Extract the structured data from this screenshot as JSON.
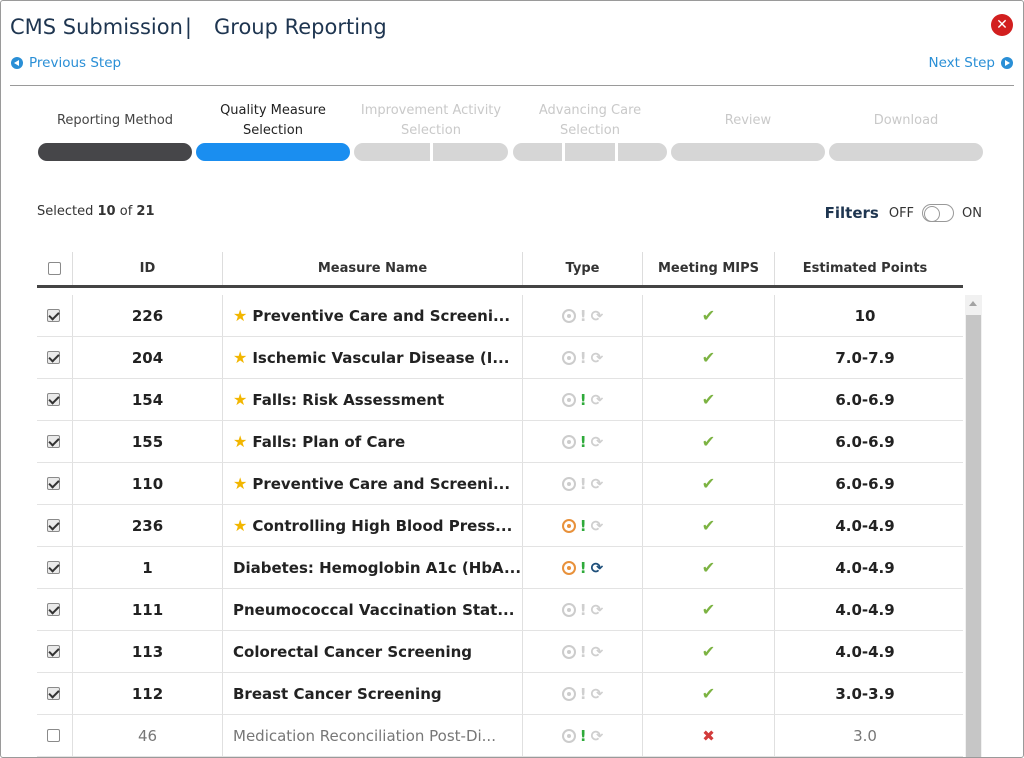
{
  "header": {
    "title": "CMS Submission",
    "separator": "|",
    "subtitle": "Group Reporting"
  },
  "nav": {
    "previous": "Previous Step",
    "next": "Next Step"
  },
  "steps": [
    {
      "label": "Reporting Method",
      "state": "done"
    },
    {
      "label": "Quality Measure Selection",
      "state": "active"
    },
    {
      "label": "Improvement Activity Selection",
      "state": "pending"
    },
    {
      "label": "Advancing Care Selection",
      "state": "pending"
    },
    {
      "label": "Review",
      "state": "pending"
    },
    {
      "label": "Download",
      "state": "pending"
    }
  ],
  "selection": {
    "prefix": "Selected",
    "count": "10",
    "of": "of",
    "total": "21"
  },
  "filters": {
    "label": "Filters",
    "off": "OFF",
    "on": "ON",
    "state": "off"
  },
  "table": {
    "headers": {
      "id": "ID",
      "name": "Measure Name",
      "type": "Type",
      "mips": "Meeting MIPS",
      "points": "Estimated Points"
    },
    "rows": [
      {
        "checked": true,
        "id": "226",
        "star": true,
        "name": "Preventive Care and Screeni...",
        "target": false,
        "excl": false,
        "sync": false,
        "mips": true,
        "points": "10"
      },
      {
        "checked": true,
        "id": "204",
        "star": true,
        "name": "Ischemic Vascular Disease (I...",
        "target": false,
        "excl": false,
        "sync": false,
        "mips": true,
        "points": "7.0-7.9"
      },
      {
        "checked": true,
        "id": "154",
        "star": true,
        "name": "Falls: Risk Assessment",
        "target": false,
        "excl": true,
        "sync": false,
        "mips": true,
        "points": "6.0-6.9"
      },
      {
        "checked": true,
        "id": "155",
        "star": true,
        "name": "Falls: Plan of Care",
        "target": false,
        "excl": true,
        "sync": false,
        "mips": true,
        "points": "6.0-6.9"
      },
      {
        "checked": true,
        "id": "110",
        "star": true,
        "name": "Preventive Care and Screeni...",
        "target": false,
        "excl": false,
        "sync": false,
        "mips": true,
        "points": "6.0-6.9"
      },
      {
        "checked": true,
        "id": "236",
        "star": true,
        "name": "Controlling High Blood Press...",
        "target": true,
        "excl": true,
        "sync": false,
        "mips": true,
        "points": "4.0-4.9"
      },
      {
        "checked": true,
        "id": "1",
        "star": false,
        "name": "Diabetes: Hemoglobin A1c (HbA...",
        "target": true,
        "excl": true,
        "sync": true,
        "mips": true,
        "points": "4.0-4.9"
      },
      {
        "checked": true,
        "id": "111",
        "star": false,
        "name": "Pneumococcal Vaccination Stat...",
        "target": false,
        "excl": false,
        "sync": false,
        "mips": true,
        "points": "4.0-4.9"
      },
      {
        "checked": true,
        "id": "113",
        "star": false,
        "name": "Colorectal Cancer Screening",
        "target": false,
        "excl": false,
        "sync": false,
        "mips": true,
        "points": "4.0-4.9"
      },
      {
        "checked": true,
        "id": "112",
        "star": false,
        "name": "Breast Cancer Screening",
        "target": false,
        "excl": false,
        "sync": false,
        "mips": true,
        "points": "3.0-3.9"
      },
      {
        "checked": false,
        "id": "46",
        "star": false,
        "name": "Medication Reconciliation Post-Di...",
        "target": false,
        "excl": true,
        "sync": false,
        "mips": false,
        "points": "3.0"
      }
    ]
  },
  "icons": {
    "close": "close-icon",
    "previous": "circle-arrow-left-icon",
    "next": "circle-arrow-right-icon",
    "star": "star-icon",
    "check": "check-icon",
    "cross": "x-icon"
  },
  "colors": {
    "accent": "#1a8ef0",
    "done": "#464649",
    "title": "#1e3550",
    "close": "#d21f1f",
    "star": "#f2b600",
    "check": "#7cb342",
    "cross": "#d23b3b"
  }
}
